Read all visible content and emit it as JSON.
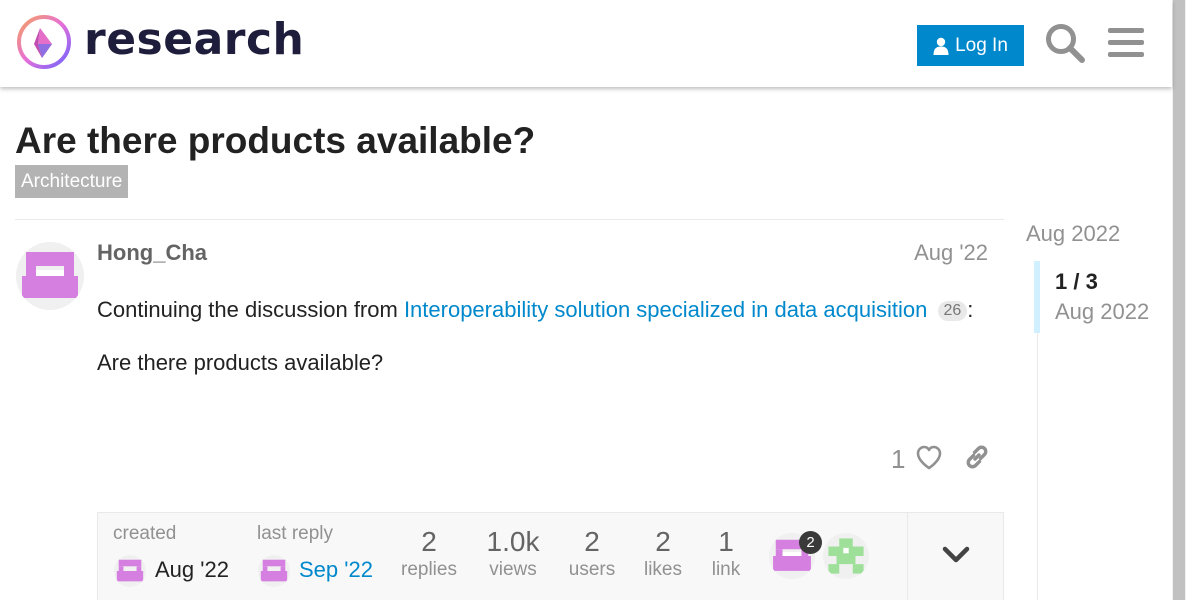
{
  "header": {
    "logo_text": "research",
    "login_label": "Log In",
    "accent": "#0088cc"
  },
  "topic": {
    "title": "Are there products available?",
    "category": "Architecture"
  },
  "post": {
    "author": "Hong_Cha",
    "date": "Aug '22",
    "intro_text": "Continuing the discussion from ",
    "linked_topic": "Interoperability solution specialized in data acquisition",
    "linked_count": "26",
    "colon": ":",
    "body": "Are there products available?",
    "like_count": "1"
  },
  "topic_map": {
    "created_label": "created",
    "created_date": "Aug '22",
    "last_reply_label": "last reply",
    "last_reply_date": "Sep '22",
    "stats": [
      {
        "value": "2",
        "label": "replies"
      },
      {
        "value": "1.0k",
        "label": "views"
      },
      {
        "value": "2",
        "label": "users"
      },
      {
        "value": "2",
        "label": "likes"
      },
      {
        "value": "1",
        "label": "link"
      }
    ],
    "participant_badge": "2"
  },
  "timeline": {
    "top_date": "Aug 2022",
    "position": "1 / 3",
    "current_date": "Aug 2022"
  },
  "icons": [
    "logo-icon",
    "user-icon",
    "search-icon",
    "menu-icon",
    "heart-icon",
    "link-icon",
    "chevron-down-icon"
  ]
}
